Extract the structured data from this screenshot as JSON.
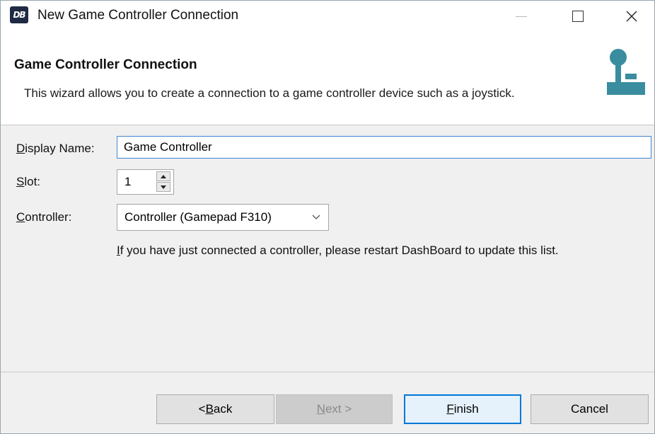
{
  "window": {
    "app_icon_text": "DB",
    "title": "New Game Controller Connection"
  },
  "header": {
    "title": "Game Controller Connection",
    "description": "This wizard allows you to create a connection to a game controller device such as a joystick."
  },
  "form": {
    "display_name": {
      "label_mnemonic": "D",
      "label_rest": "isplay Name:",
      "value": "Game Controller"
    },
    "slot": {
      "label_mnemonic": "S",
      "label_rest": "lot:",
      "value": "1"
    },
    "controller": {
      "label_mnemonic": "C",
      "label_rest": "ontroller:",
      "value": "Controller (Gamepad F310)"
    },
    "hint": "If you have just connected a controller, please restart DashBoard to update this list."
  },
  "buttons": {
    "back": {
      "prefix": "< ",
      "mnemonic": "B",
      "rest": "ack"
    },
    "next": {
      "mnemonic": "N",
      "rest": "ext >"
    },
    "finish": {
      "mnemonic": "F",
      "rest": "inish"
    },
    "cancel": {
      "label": "Cancel"
    }
  },
  "colors": {
    "accent": "#0078d7",
    "icon_teal": "#3a8d9e"
  }
}
